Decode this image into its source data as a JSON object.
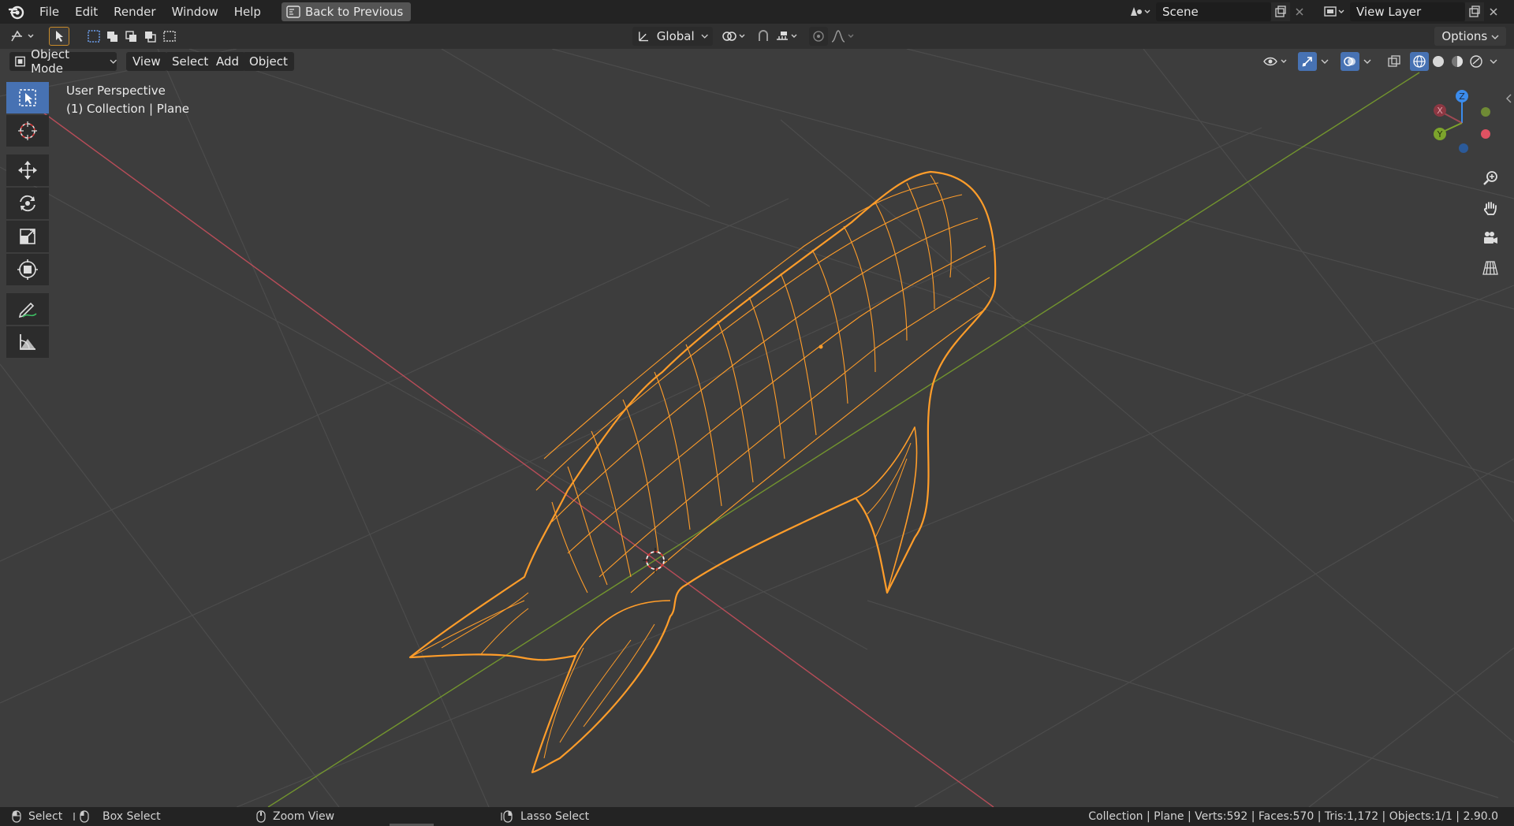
{
  "menubar": {
    "items": [
      "File",
      "Edit",
      "Render",
      "Window",
      "Help"
    ],
    "back_button": "Back to Previous",
    "scene_name": "Scene",
    "view_layer_name": "View Layer"
  },
  "tool_header": {
    "transform_orientation": "Global",
    "options_label": "Options"
  },
  "viewport": {
    "mode": "Object Mode",
    "menus": [
      "View",
      "Select",
      "Add",
      "Object"
    ],
    "info_line1": "User Perspective",
    "info_line2": "(1) Collection | Plane",
    "gizmo_labels": {
      "x": "X",
      "y": "Y",
      "z": "Z"
    }
  },
  "statusbar": {
    "select": "Select",
    "box_select": "Box Select",
    "zoom_view": "Zoom View",
    "lasso_select": "Lasso Select",
    "stats": "Collection | Plane | Verts:592 | Faces:570 | Tris:1,172 | Objects:1/1 | 2.90.0"
  },
  "colors": {
    "accent_blue": "#4772b3",
    "selection_orange": "#ff9d2a",
    "axis_x_red": "#e05262",
    "axis_y_green": "#7ca42c",
    "axis_z_blue": "#3b8ced"
  }
}
